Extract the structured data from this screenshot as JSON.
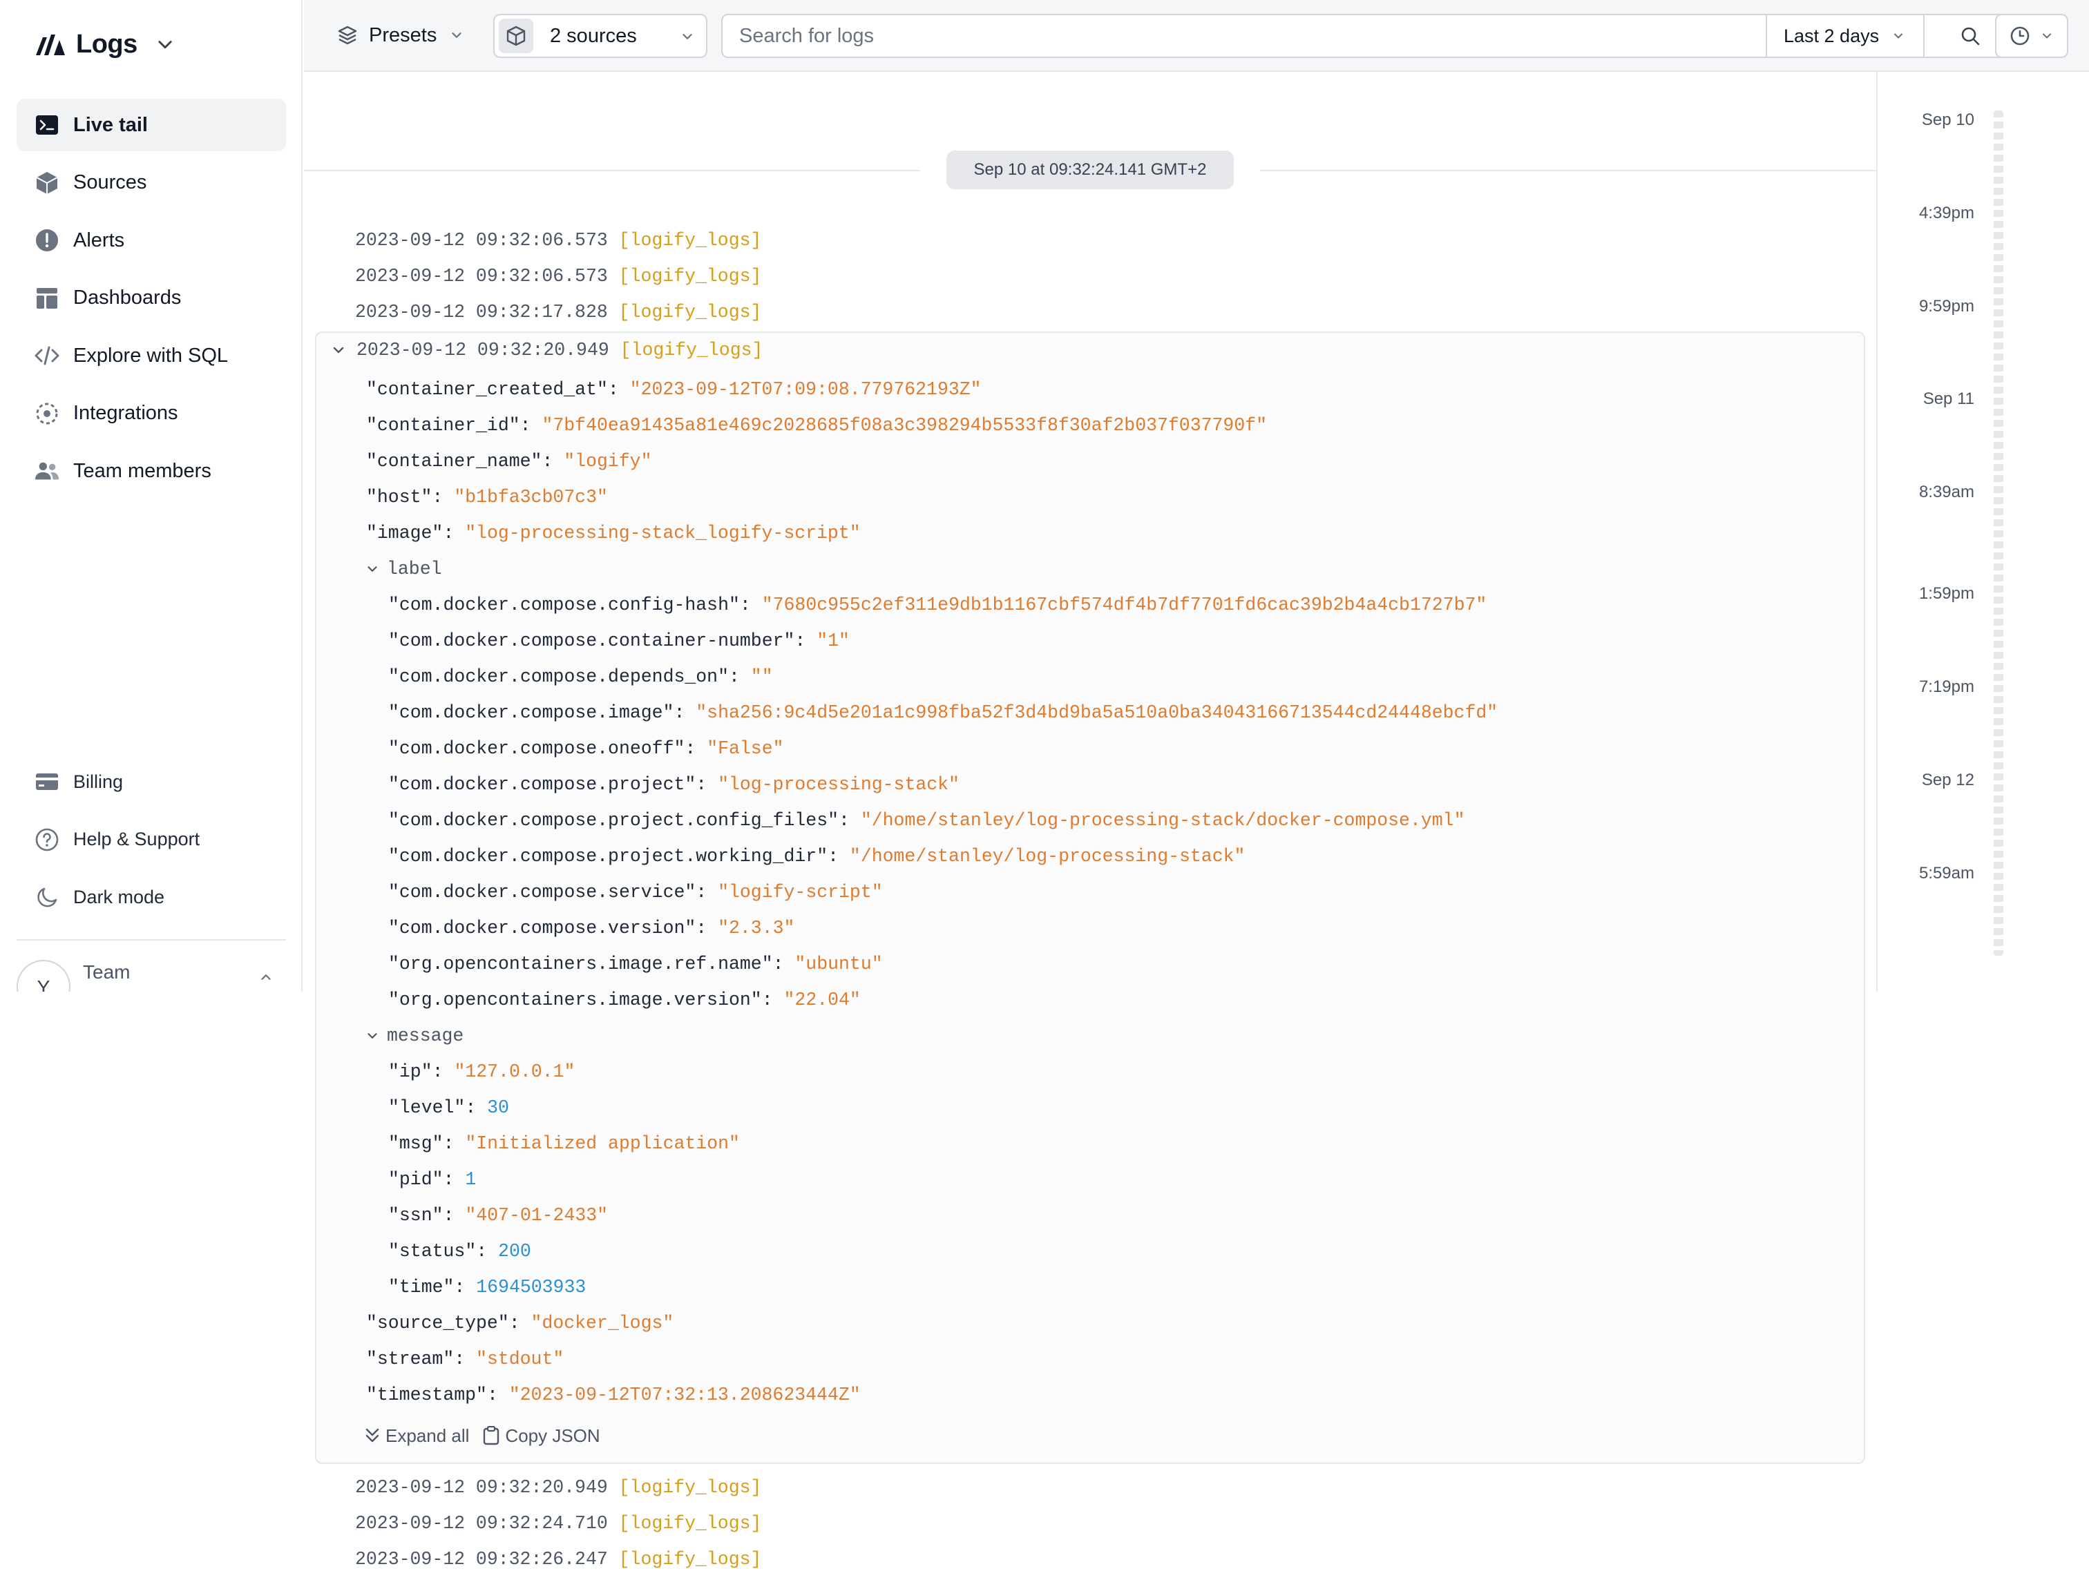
{
  "sidebar": {
    "brand": "Logs",
    "items": [
      {
        "label": "Live tail",
        "icon": "terminal-icon",
        "active": true
      },
      {
        "label": "Sources",
        "icon": "cube-icon"
      },
      {
        "label": "Alerts",
        "icon": "alert-circle-icon"
      },
      {
        "label": "Dashboards",
        "icon": "dashboard-icon"
      },
      {
        "label": "Explore with SQL",
        "icon": "code-icon"
      },
      {
        "label": "Integrations",
        "icon": "integrations-icon"
      },
      {
        "label": "Team members",
        "icon": "users-icon"
      }
    ],
    "bottom_items": [
      {
        "label": "Billing",
        "icon": "credit-card-icon"
      },
      {
        "label": "Help & Support",
        "icon": "help-circle-icon"
      },
      {
        "label": "Dark mode",
        "icon": "moon-icon"
      }
    ],
    "team": {
      "avatar_letter": "Y",
      "label": "Team"
    }
  },
  "topbar": {
    "presets_label": "Presets",
    "sources_label": "2 sources",
    "search_placeholder": "Search for logs",
    "range_label": "Last 2 days"
  },
  "timeline": {
    "labels": [
      "Sep 10",
      "4:39pm",
      "9:59pm",
      "Sep 11",
      "8:39am",
      "1:59pm",
      "7:19pm",
      "Sep 12",
      "5:59am"
    ]
  },
  "logs": {
    "date_separator": "Sep 10 at 09:32:24.141 GMT+2",
    "before": [
      {
        "ts": "2023-09-12 09:32:06.573",
        "src": "[logify_logs]"
      },
      {
        "ts": "2023-09-12 09:32:06.573",
        "src": "[logify_logs]"
      },
      {
        "ts": "2023-09-12 09:32:17.828",
        "src": "[logify_logs]"
      }
    ],
    "expanded": {
      "ts": "2023-09-12 09:32:20.949",
      "src": "[logify_logs]",
      "fields": [
        {
          "k": "\"container_created_at\"",
          "v": "\"2023-09-12T07:09:08.779762193Z\"",
          "t": "s",
          "indent": 0
        },
        {
          "k": "\"container_id\"",
          "v": "\"7bf40ea91435a81e469c2028685f08a3c398294b5533f8f30af2b037f037790f\"",
          "t": "s",
          "indent": 0
        },
        {
          "k": "\"container_name\"",
          "v": "\"logify\"",
          "t": "s",
          "indent": 0
        },
        {
          "k": "\"host\"",
          "v": "\"b1bfa3cb07c3\"",
          "t": "s",
          "indent": 0
        },
        {
          "k": "\"image\"",
          "v": "\"log-processing-stack_logify-script\"",
          "t": "s",
          "indent": 0
        },
        {
          "group": "label",
          "indent": 0
        },
        {
          "k": "\"com.docker.compose.config-hash\"",
          "v": "\"7680c955c2ef311e9db1b1167cbf574df4b7df7701fd6cac39b2b4a4cb1727b7\"",
          "t": "s",
          "indent": 1
        },
        {
          "k": "\"com.docker.compose.container-number\"",
          "v": "\"1\"",
          "t": "s",
          "indent": 1
        },
        {
          "k": "\"com.docker.compose.depends_on\"",
          "v": "\"\"",
          "t": "s",
          "indent": 1
        },
        {
          "k": "\"com.docker.compose.image\"",
          "v": "\"sha256:9c4d5e201a1c998fba52f3d4bd9ba5a510a0ba34043166713544cd24448ebcfd\"",
          "t": "s",
          "indent": 1
        },
        {
          "k": "\"com.docker.compose.oneoff\"",
          "v": "\"False\"",
          "t": "s",
          "indent": 1
        },
        {
          "k": "\"com.docker.compose.project\"",
          "v": "\"log-processing-stack\"",
          "t": "s",
          "indent": 1
        },
        {
          "k": "\"com.docker.compose.project.config_files\"",
          "v": "\"/home/stanley/log-processing-stack/docker-compose.yml\"",
          "t": "s",
          "indent": 1
        },
        {
          "k": "\"com.docker.compose.project.working_dir\"",
          "v": "\"/home/stanley/log-processing-stack\"",
          "t": "s",
          "indent": 1
        },
        {
          "k": "\"com.docker.compose.service\"",
          "v": "\"logify-script\"",
          "t": "s",
          "indent": 1
        },
        {
          "k": "\"com.docker.compose.version\"",
          "v": "\"2.3.3\"",
          "t": "s",
          "indent": 1
        },
        {
          "k": "\"org.opencontainers.image.ref.name\"",
          "v": "\"ubuntu\"",
          "t": "s",
          "indent": 1
        },
        {
          "k": "\"org.opencontainers.image.version\"",
          "v": "\"22.04\"",
          "t": "s",
          "indent": 1
        },
        {
          "group": "message",
          "indent": 0
        },
        {
          "k": "\"ip\"",
          "v": "\"127.0.0.1\"",
          "t": "s",
          "indent": 1
        },
        {
          "k": "\"level\"",
          "v": "30",
          "t": "n",
          "indent": 1
        },
        {
          "k": "\"msg\"",
          "v": "\"Initialized application\"",
          "t": "s",
          "indent": 1
        },
        {
          "k": "\"pid\"",
          "v": "1",
          "t": "n",
          "indent": 1
        },
        {
          "k": "\"ssn\"",
          "v": "\"407-01-2433\"",
          "t": "s",
          "indent": 1
        },
        {
          "k": "\"status\"",
          "v": "200",
          "t": "n",
          "indent": 1
        },
        {
          "k": "\"time\"",
          "v": "1694503933",
          "t": "n",
          "indent": 1
        },
        {
          "k": "\"source_type\"",
          "v": "\"docker_logs\"",
          "t": "s",
          "indent": 0
        },
        {
          "k": "\"stream\"",
          "v": "\"stdout\"",
          "t": "s",
          "indent": 0
        },
        {
          "k": "\"timestamp\"",
          "v": "\"2023-09-12T07:32:13.208623444Z\"",
          "t": "s",
          "indent": 0
        }
      ],
      "expand_all_label": "Expand all",
      "copy_json_label": "Copy JSON"
    },
    "after": [
      {
        "ts": "2023-09-12 09:32:20.949",
        "src": "[logify_logs]"
      },
      {
        "ts": "2023-09-12 09:32:24.710",
        "src": "[logify_logs]"
      },
      {
        "ts": "2023-09-12 09:32:26.247",
        "src": "[logify_logs]"
      }
    ]
  },
  "colors": {
    "string_value": "#e07b2e",
    "number_value": "#2b8fd6",
    "source_tag": "#d69e1a",
    "active_nav_bg": "#f1f2f4"
  }
}
